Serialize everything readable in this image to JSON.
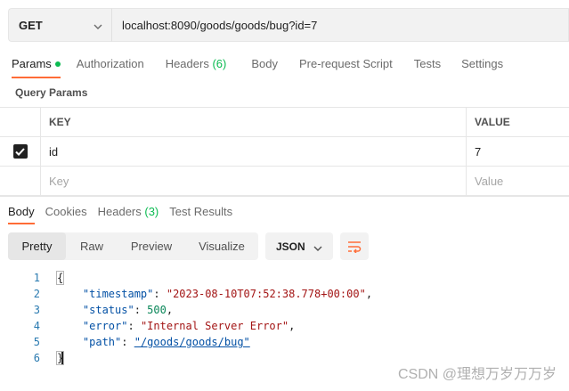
{
  "request": {
    "method": "GET",
    "url": "localhost:8090/goods/goods/bug?id=7"
  },
  "request_tabs": [
    {
      "label": "Params",
      "active": true,
      "dot": true
    },
    {
      "label": "Authorization"
    },
    {
      "label": "Headers",
      "count": "(6)"
    },
    {
      "label": "Body"
    },
    {
      "label": "Pre-request Script"
    },
    {
      "label": "Tests"
    },
    {
      "label": "Settings"
    }
  ],
  "query_params": {
    "title": "Query Params",
    "columns": {
      "key": "KEY",
      "value": "VALUE"
    },
    "rows": [
      {
        "checked": true,
        "key": "id",
        "value": "7"
      }
    ],
    "placeholder": {
      "key": "Key",
      "value": "Value"
    }
  },
  "response_tabs": [
    {
      "label": "Body",
      "active": true
    },
    {
      "label": "Cookies"
    },
    {
      "label": "Headers",
      "count": "(3)"
    },
    {
      "label": "Test Results"
    }
  ],
  "format_toolbar": {
    "buttons": [
      "Pretty",
      "Raw",
      "Preview",
      "Visualize"
    ],
    "active": "Pretty",
    "language": "JSON"
  },
  "response_body": {
    "line_numbers": [
      "1",
      "2",
      "3",
      "4",
      "5",
      "6"
    ],
    "open_brace": "{",
    "close_brace": "}",
    "fields": [
      {
        "key": "\"timestamp\"",
        "value": "\"2023-08-10T07:52:38.778+00:00\"",
        "type": "string",
        "comma": ","
      },
      {
        "key": "\"status\"",
        "value": "500",
        "type": "number",
        "comma": ","
      },
      {
        "key": "\"error\"",
        "value": "\"Internal Server Error\"",
        "type": "string",
        "comma": ","
      },
      {
        "key": "\"path\"",
        "value": "\"/goods/goods/bug\"",
        "type": "link",
        "comma": ""
      }
    ]
  },
  "watermark": "CSDN @理想万岁万万岁",
  "colors": {
    "accent": "#ff6c37",
    "indicator": "#0cbb52",
    "json_key": "#0451a5",
    "json_string": "#a31515",
    "json_number": "#098658"
  }
}
